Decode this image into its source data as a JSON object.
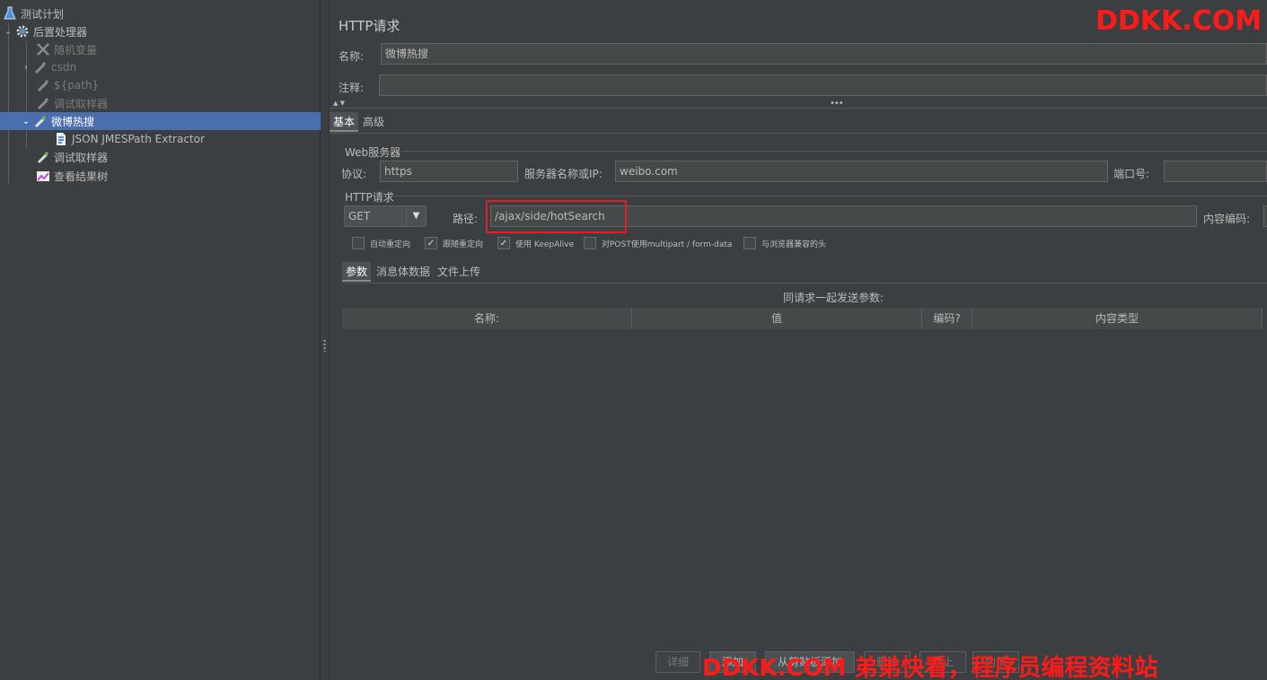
{
  "tree": {
    "items": [
      {
        "label": "测试计划",
        "icon": "flask-icon"
      },
      {
        "label": "后置处理器",
        "icon": "gear-icon"
      },
      {
        "label": "随机变量",
        "icon": "wrench-icon"
      },
      {
        "label": "csdn",
        "icon": "pipette-icon"
      },
      {
        "label": "${path}",
        "icon": "pipette-icon"
      },
      {
        "label": "调试取样器",
        "icon": "pipette-icon"
      },
      {
        "label": "微博热搜",
        "icon": "pipette-icon"
      },
      {
        "label": "JSON JMESPath Extractor",
        "icon": "document-icon"
      },
      {
        "label": "调试取样器",
        "icon": "pipette-icon"
      },
      {
        "label": "查看结果树",
        "icon": "chart-icon"
      }
    ]
  },
  "panel": {
    "title": "HTTP请求",
    "name_label": "名称:",
    "name_value": "微博热搜",
    "comment_label": "注释:",
    "comment_value": "",
    "tabs": [
      "基本",
      "高级"
    ],
    "web_server_group": "Web服务器",
    "protocol_label": "协议:",
    "protocol_value": "https",
    "server_label": "服务器名称或IP:",
    "server_value": "weibo.com",
    "port_label": "端口号:",
    "port_value": "",
    "http_request_group": "HTTP请求",
    "method_value": "GET",
    "path_label": "路径:",
    "path_value": "/ajax/side/hotSearch",
    "encoding_label": "内容编码:",
    "checkboxes": [
      {
        "label": "自动重定向",
        "checked": false
      },
      {
        "label": "跟随重定向",
        "checked": true
      },
      {
        "label": "使用 KeepAlive",
        "checked": true
      },
      {
        "label": "对POST使用multipart / form-data",
        "checked": false
      },
      {
        "label": "与浏览器兼容的头",
        "checked": false
      }
    ],
    "sub_tabs": [
      "参数",
      "消息体数据",
      "文件上传"
    ],
    "params_caption": "同请求一起发送参数:",
    "columns": [
      "名称:",
      "值",
      "编码?",
      "内容类型"
    ],
    "buttons": [
      "详细",
      "添加",
      "从剪贴板添加",
      "删除",
      "向上",
      "向下"
    ]
  },
  "watermarks": {
    "top": "DDKK.COM",
    "bottom": "DDKK.COM 弟弟快看，程序员编程资料站"
  },
  "colors": {
    "selected_row": "#4b6eaf",
    "highlight_box": "#e02020",
    "watermark": "#ff1a1a"
  }
}
